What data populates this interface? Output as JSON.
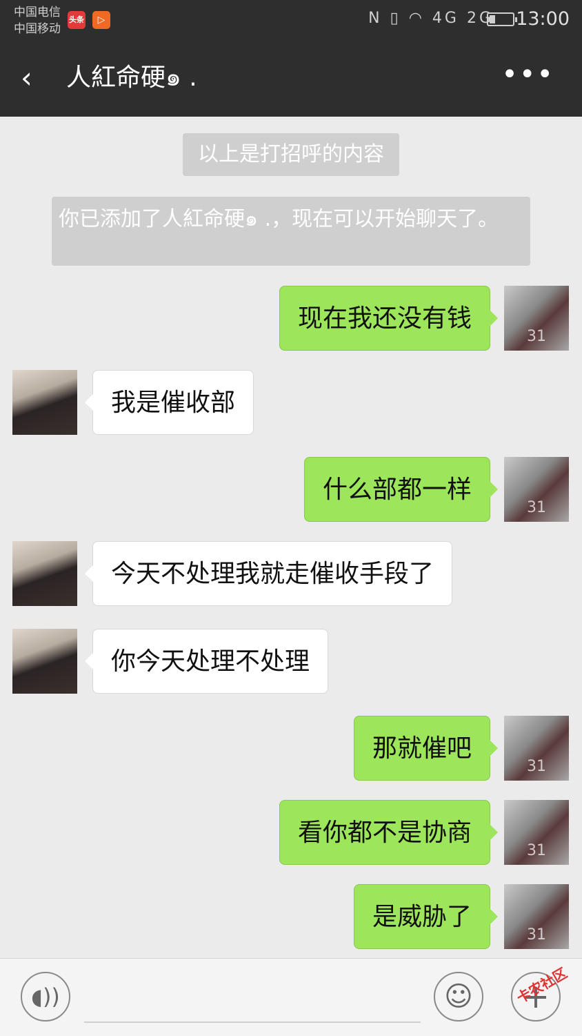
{
  "status_bar": {
    "carrier1": "中国电信",
    "carrier2": "中国移动",
    "app_icon_1": "头条",
    "app_icon_2": "▷",
    "sys_icons_text": "N ▯ ◠ 4G 2G",
    "battery_level_pct": 25,
    "time": "13:00"
  },
  "header": {
    "back_icon": "‹",
    "title": "人紅命硬๑ .",
    "more_icon": "•••"
  },
  "system_messages": [
    "以上是打招呼的内容",
    "你已添加了人紅命硬๑ .，现在可以开始聊天了。"
  ],
  "messages": [
    {
      "from": "me",
      "text": "现在我还没有钱"
    },
    {
      "from": "them",
      "text": "我是催收部"
    },
    {
      "from": "me",
      "text": "什么部都一样"
    },
    {
      "from": "them",
      "text": "今天不处理我就走催收手段了"
    },
    {
      "from": "them",
      "text": "你今天处理不处理"
    },
    {
      "from": "me",
      "text": "那就催吧"
    },
    {
      "from": "me",
      "text": "看你都不是协商"
    },
    {
      "from": "me",
      "text": "是威胁了"
    }
  ],
  "avatar_me_mark": "31",
  "input_bar": {
    "voice_icon": "◖))",
    "emoji_icon": "☺",
    "plus_icon": "+",
    "watermark": "卡农社区"
  },
  "colors": {
    "header_bg": "#2e2e2e",
    "chat_bg": "#ebebeb",
    "my_bubble": "#9de55a",
    "their_bubble": "#ffffff"
  }
}
